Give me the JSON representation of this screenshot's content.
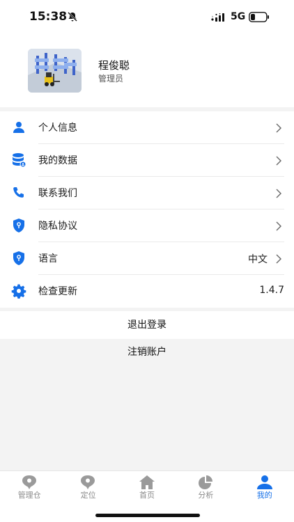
{
  "status_bar": {
    "time": "15:38",
    "network": "5G"
  },
  "profile": {
    "name": "程俊聪",
    "role": "管理员"
  },
  "menu": [
    {
      "label": "个人信息",
      "value": "",
      "icon": "person-icon"
    },
    {
      "label": "我的数据",
      "value": "",
      "icon": "database-icon"
    },
    {
      "label": "联系我们",
      "value": "",
      "icon": "phone-icon"
    },
    {
      "label": "隐私协议",
      "value": "",
      "icon": "shield-icon"
    },
    {
      "label": "语言",
      "value": "中文",
      "icon": "shield-icon"
    },
    {
      "label": "检查更新",
      "value": "1.4.7",
      "icon": "gear-icon"
    }
  ],
  "actions": {
    "logout": "退出登录",
    "deregister": "注销账户"
  },
  "tabs": [
    {
      "label": "管理仓",
      "icon": "location-pin-icon",
      "active": false
    },
    {
      "label": "定位",
      "icon": "location-pin-icon",
      "active": false
    },
    {
      "label": "首页",
      "icon": "home-icon",
      "active": false
    },
    {
      "label": "分析",
      "icon": "pie-chart-icon",
      "active": false
    },
    {
      "label": "我的",
      "icon": "user-icon",
      "active": true
    }
  ],
  "colors": {
    "accent": "#1670e8",
    "inactive": "#8a8a8a",
    "background": "#f3f3f3"
  }
}
